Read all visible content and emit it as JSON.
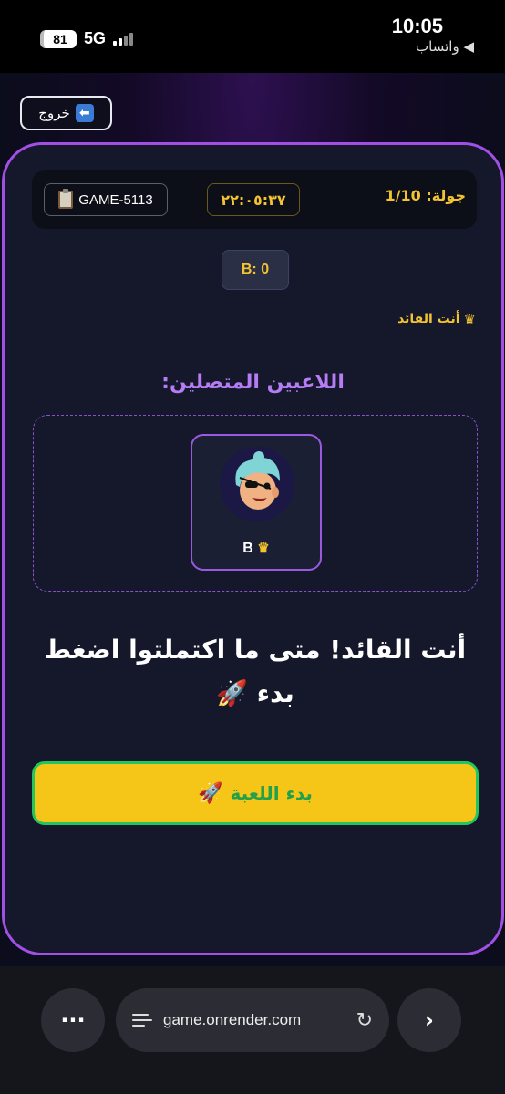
{
  "status_bar": {
    "time": "10:05",
    "back_app": "◀ واتساب",
    "battery": "81",
    "network": "5G"
  },
  "header": {
    "exit_label": "خروج",
    "exit_icon": "arrow-left-icon"
  },
  "game": {
    "code": "GAME-5113",
    "timer": "٢٢:٠٥:٣٧",
    "round_label": "جولة: 1/10",
    "score": "B: 0",
    "leader_tag": "أنت القائد",
    "players_title": "اللاعبين المتصلين:",
    "players": [
      {
        "name": "B",
        "is_leader": true
      }
    ],
    "message": "أنت القائد! متى ما اكتملتوا اضغط بدء 🚀",
    "start_label": "بدء اللعبة"
  },
  "browser": {
    "url": "game.onrender.com"
  },
  "colors": {
    "accent_purple": "#a24fe6",
    "gold": "#f4c430",
    "button_yellow": "#f5c518",
    "button_border_green": "#22c55e"
  }
}
